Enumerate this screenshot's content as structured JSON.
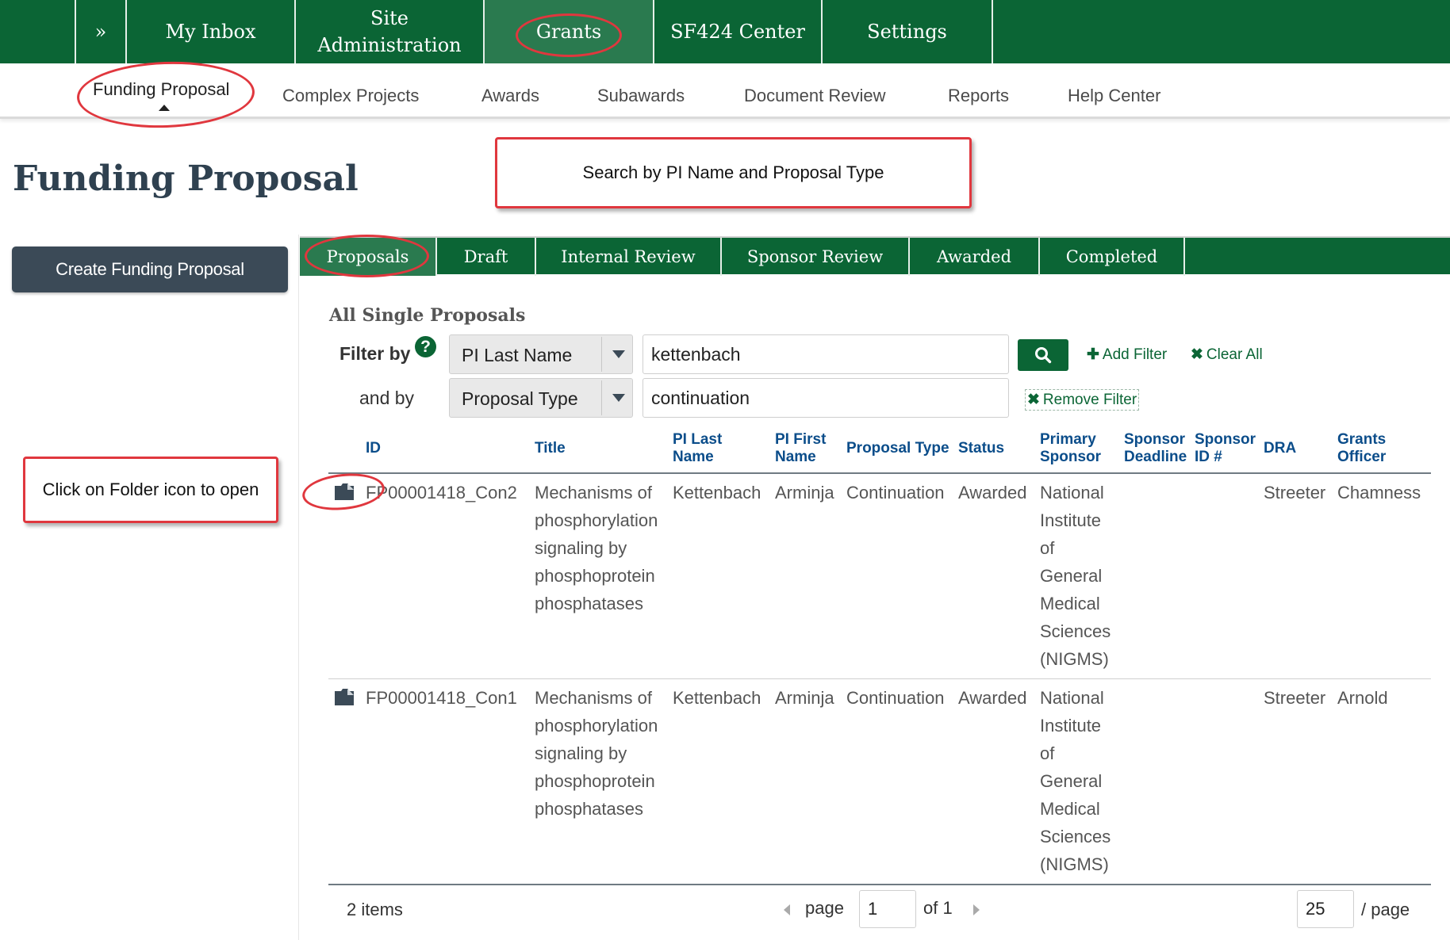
{
  "top_nav": {
    "toggle_label": "»",
    "items": [
      {
        "label": "My Inbox"
      },
      {
        "label": "Site Administration"
      },
      {
        "label": "Grants"
      },
      {
        "label": "SF424 Center"
      },
      {
        "label": "Settings"
      }
    ],
    "active": "Grants"
  },
  "sub_nav": {
    "items": [
      {
        "label": "Funding Proposal"
      },
      {
        "label": "Complex Projects"
      },
      {
        "label": "Awards"
      },
      {
        "label": "Subawards"
      },
      {
        "label": "Document Review"
      },
      {
        "label": "Reports"
      },
      {
        "label": "Help Center"
      }
    ],
    "active": "Funding Proposal"
  },
  "page": {
    "title": "Funding Proposal",
    "create_button_label": "Create Funding Proposal"
  },
  "tabs": {
    "items": [
      {
        "label": "Proposals"
      },
      {
        "label": "Draft"
      },
      {
        "label": "Internal Review"
      },
      {
        "label": "Sponsor Review"
      },
      {
        "label": "Awarded"
      },
      {
        "label": "Completed"
      }
    ],
    "active": "Proposals"
  },
  "filters": {
    "section_title": "All Single Proposals",
    "filter_by_label": "Filter by",
    "help_icon_glyph": "?",
    "and_by_label": "and by",
    "rows": [
      {
        "field": "PI Last Name",
        "value": "kettenbach"
      },
      {
        "field": "Proposal Type",
        "value": "continuation"
      }
    ],
    "add_filter_label": "Add Filter",
    "clear_all_label": "Clear All",
    "remove_filter_label": "Remove Filter"
  },
  "table": {
    "headers": {
      "id": "ID",
      "title": "Title",
      "pi_last_name": [
        "PI Last",
        "Name"
      ],
      "pi_first_name": [
        "PI First",
        "Name"
      ],
      "proposal_type": "Proposal Type",
      "status": "Status",
      "primary_sponsor": [
        "Primary",
        "Sponsor"
      ],
      "sponsor_deadline": [
        "Sponsor",
        "Deadline"
      ],
      "sponsor_id": [
        "Sponsor",
        "ID #"
      ],
      "dra": "DRA",
      "grants_officer": [
        "Grants",
        "Officer"
      ]
    },
    "rows": [
      {
        "id": "FP00001418_Con2",
        "title_lines": [
          "Mechanisms of",
          "phosphorylation",
          "signaling by",
          "phosphoprotein",
          "phosphatases"
        ],
        "pi_last_name": "Kettenbach",
        "pi_first_name": "Arminja",
        "proposal_type": "Continuation",
        "status": "Awarded",
        "sponsor_lines": [
          "National",
          "Institute",
          "of",
          "General",
          "Medical",
          "Sciences",
          "(NIGMS)"
        ],
        "sponsor_deadline": "",
        "sponsor_id": "",
        "dra": "Streeter",
        "grants_officer": "Chamness"
      },
      {
        "id": "FP00001418_Con1",
        "title_lines": [
          "Mechanisms of",
          "phosphorylation",
          "signaling by",
          "phosphoprotein",
          "phosphatases"
        ],
        "pi_last_name": "Kettenbach",
        "pi_first_name": "Arminja",
        "proposal_type": "Continuation",
        "status": "Awarded",
        "sponsor_lines": [
          "National",
          "Institute",
          "of",
          "General",
          "Medical",
          "Sciences",
          "(NIGMS)"
        ],
        "sponsor_deadline": "",
        "sponsor_id": "",
        "dra": "Streeter",
        "grants_officer": "Arnold"
      }
    ]
  },
  "pager": {
    "items_count": "2 items",
    "page_label": "page",
    "current_page": "1",
    "of_label": "of 1",
    "page_size": "25",
    "per_page_label": "/ page"
  },
  "annotations": {
    "search_note": "Search by PI Name and Proposal Type",
    "folder_note": "Click on Folder icon to open",
    "highlight_color": "#e0373e"
  },
  "colors": {
    "brand_green": "#0b6535",
    "active_green": "#2a7a4f",
    "button_slate": "#3b4a57",
    "header_blue": "#0b4d8a"
  },
  "icons": {
    "toggle": "double-chevron-right-icon",
    "help": "question-circle-icon",
    "search": "magnifier-icon",
    "add_filter": "plus-icon",
    "clear_all": "x-icon",
    "remove_filter": "x-icon",
    "open_folder": "folder-icon",
    "pager_prev": "triangle-left-icon",
    "pager_next": "triangle-right-icon"
  }
}
